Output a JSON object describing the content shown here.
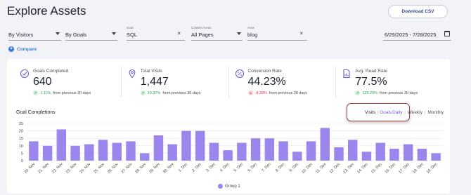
{
  "header": {
    "title": "Explore Assets",
    "download_label": "Download CSV"
  },
  "filters": [
    {
      "caption": "",
      "value": "By Visitors",
      "kind": "select"
    },
    {
      "caption": "",
      "value": "By Goals",
      "kind": "select"
    },
    {
      "caption": "Goal",
      "value": "SQL",
      "kind": "clear"
    },
    {
      "caption": "Content Areas",
      "value": "All Pages",
      "kind": "select"
    },
    {
      "caption": "Area",
      "value": "blog",
      "kind": "clear"
    }
  ],
  "date_range": "6/29/2025  - 7/28/2025",
  "compare_label": "Compare",
  "kpis": [
    {
      "label": "Goals Completed",
      "value": "640",
      "change": "1.11%",
      "direction": "up",
      "suffix": "from previous 30 days",
      "icon": "check-badge-icon"
    },
    {
      "label": "Total Visits",
      "value": "1,447",
      "change": "10.37%",
      "direction": "up",
      "suffix": "from previous 30 days",
      "icon": "location-pin-icon"
    },
    {
      "label": "Conversion Rate",
      "value": "44.23%",
      "change": "-8.39%",
      "direction": "down",
      "suffix": "from previous 30 days",
      "icon": "percent-badge-icon"
    },
    {
      "label": "Avg. Read Rate",
      "value": "77.5%",
      "change": "129.29%",
      "direction": "up",
      "suffix": "from previous 30 days",
      "icon": "document-chart-icon"
    }
  ],
  "chart_section": {
    "title": "Goal Completions",
    "metric_toggle": [
      "Visits",
      "Goals"
    ],
    "active_metric": "Goals",
    "periods": [
      "Daily",
      "Weekly",
      "Monthly"
    ],
    "active_period": "Daily"
  },
  "colors": {
    "accent": "#6f5bd6",
    "bar": "#9b86ee",
    "up": "#23a05a",
    "down": "#d6324f",
    "link": "#3d7be0"
  },
  "chart_data": {
    "type": "bar",
    "categories": [
      "20. Nov",
      "21. Nov",
      "22. Nov",
      "23. Nov",
      "24. Nov",
      "25. Nov",
      "26. Nov",
      "27. Nov",
      "28. Nov",
      "29. Nov",
      "30. Nov",
      "1. Dec",
      "2. Dec",
      "3. Dec",
      "4. Dec",
      "5. Dec",
      "6. Dec",
      "7. Dec",
      "8. Dec",
      "9. Dec",
      "10. Dec",
      "11. Dec",
      "12. Dec",
      "13. Dec",
      "14. Dec",
      "15. Dec",
      "16. Dec",
      "17. Dec",
      "18. Dec",
      "19. Dec"
    ],
    "series": [
      {
        "name": "Group 1",
        "values": [
          13,
          10,
          21,
          10,
          11,
          14,
          12,
          13,
          5,
          17,
          11,
          20,
          20,
          12,
          7,
          12,
          15,
          15,
          13,
          6,
          13,
          22,
          9,
          14,
          6,
          12,
          8,
          11,
          8,
          5
        ]
      }
    ],
    "ylim": [
      0,
      25
    ],
    "yticks": [
      0,
      5,
      10,
      15,
      20,
      25
    ],
    "grid": true,
    "legend": "bottom"
  }
}
